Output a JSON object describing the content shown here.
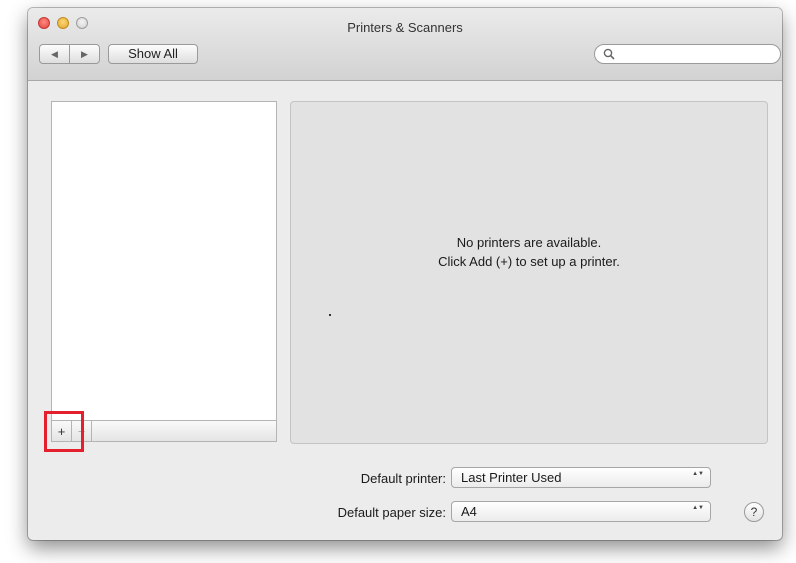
{
  "window": {
    "title": "Printers & Scanners"
  },
  "toolbar": {
    "back_glyph": "◀",
    "forward_glyph": "▶",
    "show_all_label": "Show All",
    "search_placeholder": ""
  },
  "printer_list": {
    "items": [],
    "add_label": "+",
    "remove_label": "−"
  },
  "detail": {
    "message_line1": "No printers are available.",
    "message_line2": "Click Add (+) to set up a printer."
  },
  "defaults": {
    "printer_label": "Default printer:",
    "printer_value": "Last Printer Used",
    "paper_label": "Default paper size:",
    "paper_value": "A4"
  },
  "help": {
    "label": "?"
  },
  "colors": {
    "highlight": "#e4202e",
    "window_bg": "#ececec",
    "detail_bg": "#e2e2e2"
  },
  "icons": {
    "search": "magnifier-icon",
    "popup": "up-down-arrows-icon"
  }
}
